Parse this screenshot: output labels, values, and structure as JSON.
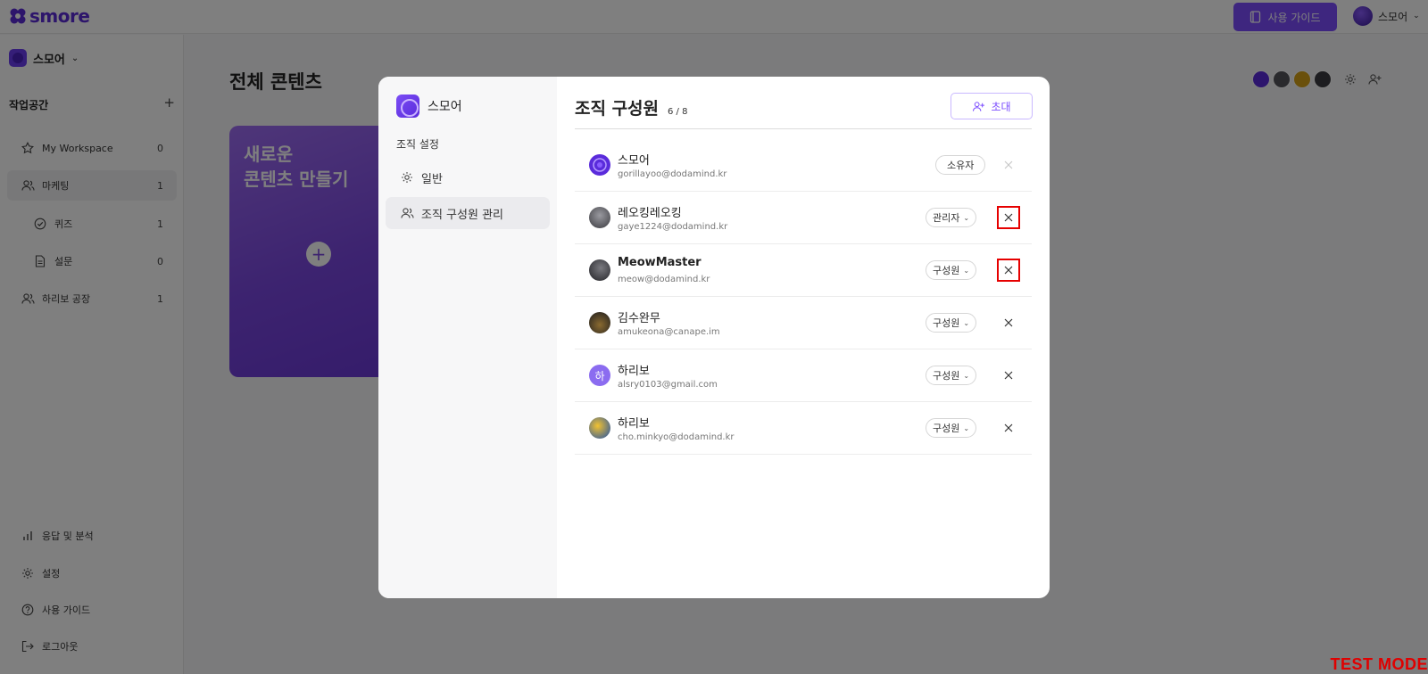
{
  "app": {
    "logo_text": "smore",
    "guide_button": "사용 가이드",
    "user_name": "스모어"
  },
  "sidebar": {
    "org_name": "스모어",
    "workspace_section": "작업공간",
    "workspace_add": "+",
    "items": [
      {
        "label": "My Workspace",
        "count": "0",
        "icon": "star-icon"
      },
      {
        "label": "마케팅",
        "count": "1",
        "icon": "users-icon"
      },
      {
        "label": "퀴즈",
        "count": "1",
        "icon": "check-circle-icon"
      },
      {
        "label": "설문",
        "count": "0",
        "icon": "document-icon"
      },
      {
        "label": "하리보 공장",
        "count": "1",
        "icon": "users-icon"
      }
    ],
    "bottom": [
      {
        "label": "응답 및 분석",
        "icon": "bar-chart-icon"
      },
      {
        "label": "설정",
        "icon": "gear-icon"
      },
      {
        "label": "사용 가이드",
        "icon": "help-icon"
      },
      {
        "label": "로그아웃",
        "icon": "logout-icon"
      }
    ]
  },
  "main": {
    "title": "전체 콘텐츠",
    "new_card_line1": "새로운",
    "new_card_line2": "콘텐츠 만들기",
    "new_card_plus": "+"
  },
  "modal": {
    "org_name": "스모어",
    "nav_section": "조직 설정",
    "nav_items": [
      {
        "label": "일반",
        "icon": "gear-icon"
      },
      {
        "label": "조직 구성원 관리",
        "icon": "users-icon"
      }
    ],
    "title": "조직 구성원",
    "count": "6 / 8",
    "invite_button": "초대",
    "members": [
      {
        "name": "스모어",
        "email": "gorillayoo@dodamind.kr",
        "role": "소유자",
        "role_dropdown": false,
        "avatar_color": "#5a2bdb",
        "avatar_text": ""
      },
      {
        "name": "레오킹레오킹",
        "email": "gaye1224@dodamind.kr",
        "role": "관리자",
        "role_dropdown": true,
        "avatar_color": "#55555b",
        "avatar_text": ""
      },
      {
        "name": "MeowMaster",
        "email": "meow@dodamind.kr",
        "role": "구성원",
        "role_dropdown": true,
        "avatar_color": "#3b3b40",
        "avatar_text": ""
      },
      {
        "name": "김수완무",
        "email": "amukeona@canape.im",
        "role": "구성원",
        "role_dropdown": true,
        "avatar_color": "#2e2a2a",
        "avatar_text": ""
      },
      {
        "name": "하리보",
        "email": "alsry0103@gmail.com",
        "role": "구성원",
        "role_dropdown": true,
        "avatar_color": "#8b6cf0",
        "avatar_text": "하"
      },
      {
        "name": "하리보",
        "email": "cho.minkyo@dodamind.kr",
        "role": "구성원",
        "role_dropdown": true,
        "avatar_color": "#d4a017",
        "avatar_text": ""
      }
    ]
  },
  "test_mode": "TEST MODE",
  "colors": {
    "accent": "#7c4dff",
    "overlay": "rgba(0,0,0,0.5)",
    "highlight": "#e60000"
  }
}
